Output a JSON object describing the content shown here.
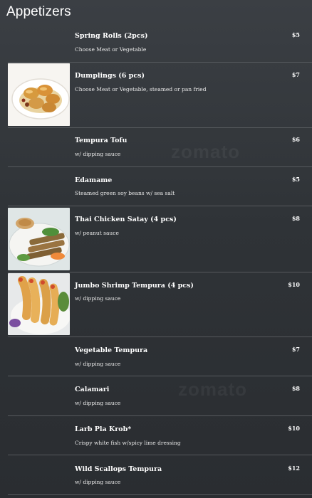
{
  "header": {
    "title": "Appetizers"
  },
  "watermark": "zomato",
  "items": [
    {
      "name": "Spring Rolls (2pcs)",
      "desc": "Choose Meat or Vegetable",
      "price": "$5"
    },
    {
      "name": "Dumplings (6 pcs)",
      "desc": "Choose Meat or Vegetable, steamed or pan fried",
      "price": "$7",
      "image": "dumplings-photo"
    },
    {
      "name": "Tempura Tofu",
      "desc": "w/ dipping sauce",
      "price": "$6"
    },
    {
      "name": "Edamame",
      "desc": "Steamed green soy beans w/ sea salt",
      "price": "$5"
    },
    {
      "name": "Thai Chicken Satay (4 pcs)",
      "desc": "w/ peanut sauce",
      "price": "$8",
      "image": "chicken-satay-photo"
    },
    {
      "name": "Jumbo Shrimp Tempura (4 pcs)",
      "desc": "w/ dipping sauce",
      "price": "$10",
      "image": "shrimp-tempura-photo"
    },
    {
      "name": "Vegetable Tempura",
      "desc": "w/ dipping sauce",
      "price": "$7"
    },
    {
      "name": "Calamari",
      "desc": "w/ dipping sauce",
      "price": "$8"
    },
    {
      "name": "Larb Pla Krob*",
      "desc": "Crispy white fish w/spicy lime dressing",
      "price": "$10"
    },
    {
      "name": "Wild Scallops Tempura",
      "desc": "w/ dipping sauce",
      "price": "$12"
    }
  ]
}
